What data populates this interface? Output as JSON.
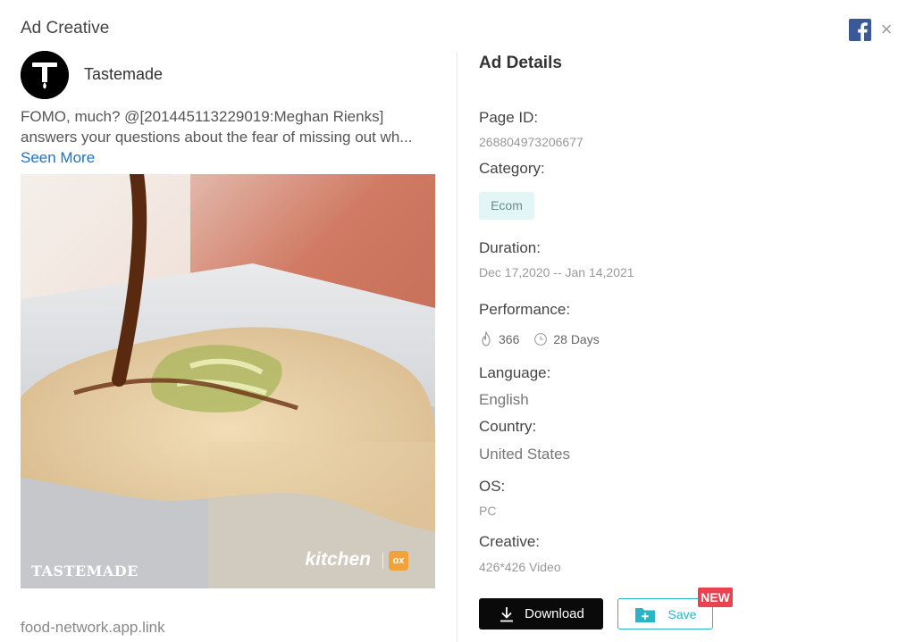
{
  "header": {
    "title": "Ad Creative",
    "icons": [
      "facebook-icon",
      "close-icon"
    ]
  },
  "ad": {
    "advertiser": "Tastemade",
    "text": "FOMO, much? @[201445113229019:Meghan Rienks] answers your questions about the fear of missing out wh...",
    "seen_more": "Seen More",
    "media_brand": "TASTEMADE",
    "media_kitchen": "kitchen",
    "media_badge": "ox",
    "link": "food-network.app.link"
  },
  "details": {
    "title": "Ad Details",
    "page_id_label": "Page ID:",
    "page_id": "268804973206677",
    "category_label": "Category:",
    "category": "Ecom",
    "duration_label": "Duration:",
    "duration": "Dec 17,2020 -- Jan 14,2021",
    "performance_label": "Performance:",
    "likes": "366",
    "days": "28 Days",
    "language_label": "Language:",
    "language": "English",
    "country_label": "Country:",
    "country": "United States",
    "os_label": "OS:",
    "os": "PC",
    "creative_label": "Creative:",
    "creative": "426*426 Video"
  },
  "actions": {
    "download": "Download",
    "save": "Save",
    "new_badge": "NEW"
  },
  "colors": {
    "accent": "#2bb5c4",
    "link": "#1a73c8",
    "badge_red": "#e8434f",
    "tag_bg": "#e3f6f6",
    "facebook": "#3b5998"
  }
}
